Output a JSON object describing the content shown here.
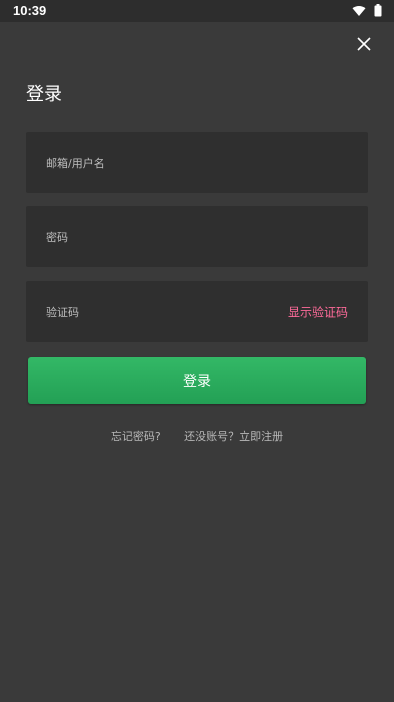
{
  "status_bar": {
    "time": "10:39",
    "icons": [
      "wifi-icon",
      "battery-icon"
    ]
  },
  "header": {
    "close_icon": "close-icon",
    "title": "登录"
  },
  "form": {
    "username": {
      "placeholder": "邮箱/用户名"
    },
    "password": {
      "placeholder": "密码"
    },
    "captcha": {
      "placeholder": "验证码",
      "show_label": "显示验证码"
    }
  },
  "actions": {
    "login_label": "登录",
    "forgot_label": "忘记密码?",
    "register_label": "还没账号？立即注册"
  },
  "colors": {
    "background": "#3a3a3a",
    "field_bg": "#2f2f2f",
    "accent_green": "#2aa85c",
    "pink_link": "#ff6b9a"
  }
}
